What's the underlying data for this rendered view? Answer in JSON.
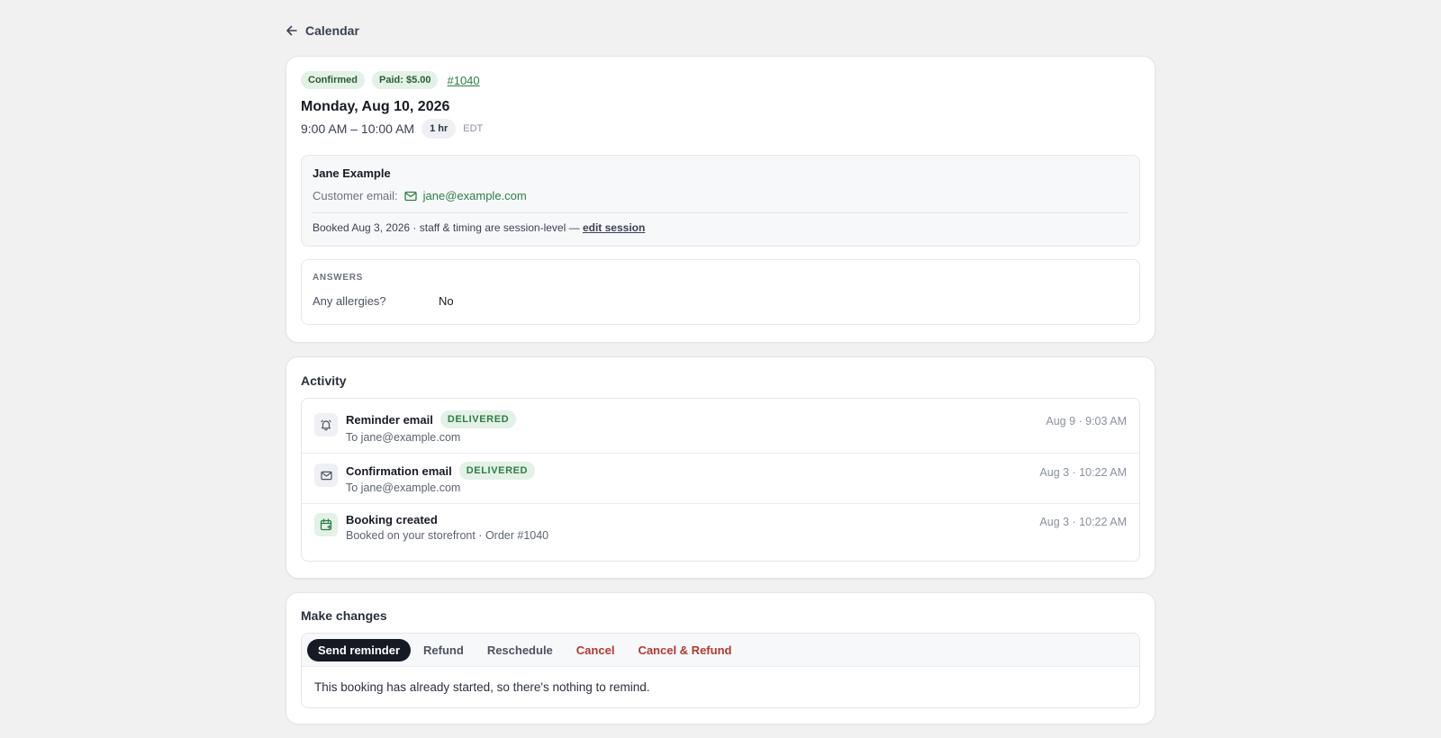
{
  "nav": {
    "back_label": "Calendar"
  },
  "booking": {
    "status_badge": "Confirmed",
    "paid_badge": "Paid: $5.00",
    "order_link": "#1040",
    "date": "Monday, Aug 10, 2026",
    "time_range": "9:00 AM – 10:00 AM",
    "duration": "1 hr",
    "timezone": "EDT"
  },
  "customer": {
    "name": "Jane Example",
    "email_label": "Customer email:",
    "email": "jane@example.com",
    "booked_text": "Booked Aug 3, 2026 · staff & timing are session-level —",
    "edit_session_link": "edit session"
  },
  "answers": {
    "title": "ANSWERS",
    "items": [
      {
        "question": "Any allergies?",
        "answer": "No"
      }
    ]
  },
  "activity": {
    "title": "Activity",
    "items": [
      {
        "icon": "bell-icon",
        "title": "Reminder email",
        "status": "DELIVERED",
        "subtitle": "To jane@example.com",
        "time": "Aug 9 · 9:03 AM"
      },
      {
        "icon": "mail-icon",
        "title": "Confirmation email",
        "status": "DELIVERED",
        "subtitle": "To jane@example.com",
        "time": "Aug 3 · 10:22 AM"
      },
      {
        "icon": "calendar-add-icon",
        "title": "Booking created",
        "status": "",
        "subtitle": "Booked on your storefront · Order #1040",
        "time": "Aug 3 · 10:22 AM"
      }
    ]
  },
  "changes": {
    "title": "Make changes",
    "tabs": [
      {
        "label": "Send reminder",
        "active": true
      },
      {
        "label": "Refund"
      },
      {
        "label": "Reschedule"
      },
      {
        "label": "Cancel",
        "danger": true
      },
      {
        "label": "Cancel & Refund",
        "danger": true
      }
    ],
    "message": "This booking has already started, so there's nothing to remind."
  },
  "colors": {
    "accent_green": "#2e7d46",
    "danger_red": "#b03a2e",
    "active_tab": "#151a25",
    "page_bg": "#f1f1f1"
  }
}
